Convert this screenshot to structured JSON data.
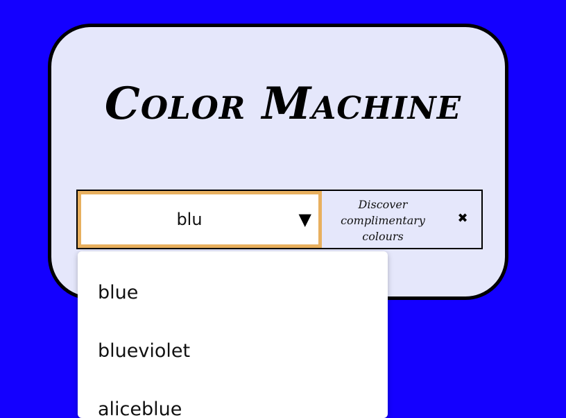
{
  "app": {
    "title": "Color Machine"
  },
  "select": {
    "value": "blu",
    "arrow_icon": "triangle-down",
    "border_color": "#e8b05f"
  },
  "discover": {
    "label": "Discover complimentary colours"
  },
  "clear": {
    "icon": "close-x"
  },
  "dropdown": {
    "options": [
      "blue",
      "blueviolet",
      "aliceblue"
    ]
  },
  "colors": {
    "background": "#1400ff",
    "card": "#e5e7fb",
    "focus_border": "#e8b05f"
  }
}
